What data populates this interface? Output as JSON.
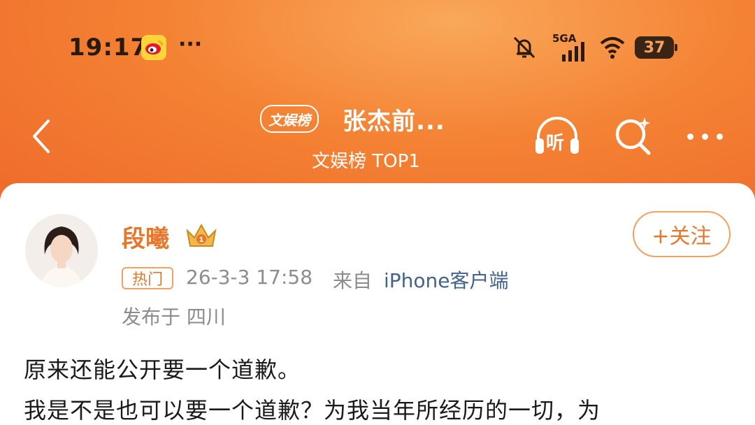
{
  "status_bar": {
    "time": "19:17",
    "app_icon": "weibo-icon",
    "more": "···",
    "network": "5GA",
    "battery": "37"
  },
  "nav": {
    "badge": "文娱榜",
    "title": "张杰前...",
    "subtitle": "文娱榜 TOP1",
    "listen_label": "听"
  },
  "post": {
    "username": "段曦",
    "follow_label": "+关注",
    "hot_tag": "热门",
    "time": "26-3-3 17:58",
    "from_label": "来自",
    "source": "iPhone客户端",
    "location": "发布于 四川",
    "lines": [
      "原来还能公开要一个道歉。",
      "我是不是也可以要一个道歉？为我当年所经历的一切，为"
    ]
  },
  "colors": {
    "header": "#f48234",
    "accent": "#e8772e",
    "link": "#44628a"
  }
}
